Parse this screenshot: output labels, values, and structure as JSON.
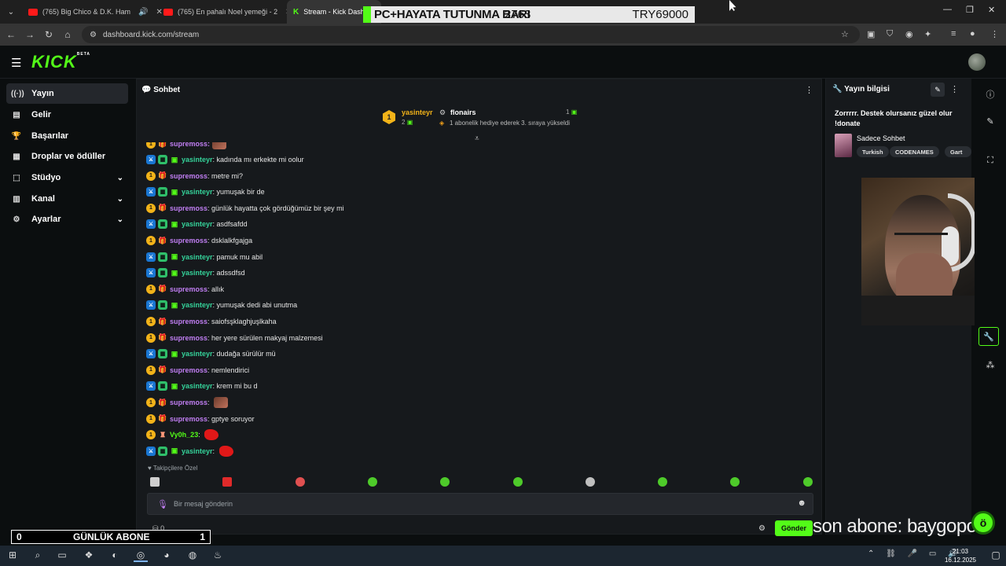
{
  "browser": {
    "tabs": [
      {
        "title": "(765) Big Chico & D.K. Ham",
        "active": false
      },
      {
        "title": "(765) En pahalı Noel yemeği - 2",
        "active": false
      },
      {
        "title": "Stream - Kick Dashboard",
        "active": true
      }
    ],
    "url": "dashboard.kick.com/stream"
  },
  "banner": {
    "text": "PC+HAYATA TUTUNMA BARI",
    "count": "2763",
    "amount": "TRY69000"
  },
  "kick": {
    "logo": "KICK",
    "logo_sup": "BETA"
  },
  "sidebar": {
    "items": [
      {
        "label": "Yayın",
        "icon": "broadcast-icon",
        "active": true
      },
      {
        "label": "Gelir",
        "icon": "revenue-icon"
      },
      {
        "label": "Başarılar",
        "icon": "trophy-icon"
      },
      {
        "label": "Droplar ve ödüller",
        "icon": "drops-icon"
      },
      {
        "label": "Stüdyo",
        "icon": "studio-icon",
        "expandable": true
      },
      {
        "label": "Kanal",
        "icon": "channel-icon",
        "expandable": true
      },
      {
        "label": "Ayarlar",
        "icon": "settings-icon",
        "expandable": true
      }
    ]
  },
  "chat": {
    "title": "Sohbet",
    "pinned": {
      "rank": "1",
      "user": "yasinteyr",
      "subs": "2",
      "gifter": "flonairs",
      "gifter_subs": "1",
      "text": "1 abonelik hediye ederek 3. sıraya yükseldi"
    },
    "messages": [
      {
        "user": "yasinteyr",
        "kind": "yas",
        "text": "kadında mı erkekte mi oolur"
      },
      {
        "user": "supremoss",
        "kind": "sup",
        "text": "metre mi?"
      },
      {
        "user": "yasinteyr",
        "kind": "yas",
        "text": "yumuşak bir de"
      },
      {
        "user": "supremoss",
        "kind": "sup",
        "text": "günlük hayatta çok gördüğümüz bir şey mi"
      },
      {
        "user": "yasinteyr",
        "kind": "yas",
        "text": "asdfsafdd"
      },
      {
        "user": "supremoss",
        "kind": "sup",
        "text": "dsklalkfgajga"
      },
      {
        "user": "yasinteyr",
        "kind": "yas",
        "text": "pamuk mu abil"
      },
      {
        "user": "yasinteyr",
        "kind": "yas",
        "text": "adssdfsd"
      },
      {
        "user": "supremoss",
        "kind": "sup",
        "text": "allık"
      },
      {
        "user": "yasinteyr",
        "kind": "yas",
        "text": "yumuşak dedi abi unutma"
      },
      {
        "user": "supremoss",
        "kind": "sup",
        "text": "saiofsşklaghjuşlkaha"
      },
      {
        "user": "supremoss",
        "kind": "sup",
        "text": "her yere sürülen makyaj malzemesi"
      },
      {
        "user": "yasinteyr",
        "kind": "yas",
        "text": "dudağa sürülür mü"
      },
      {
        "user": "supremoss",
        "kind": "sup",
        "text": "nemlendirici"
      },
      {
        "user": "yasinteyr",
        "kind": "yas",
        "text": "krem mi bu d"
      },
      {
        "user": "supremoss",
        "kind": "sup",
        "text": "",
        "emote": "brown"
      },
      {
        "user": "supremoss",
        "kind": "sup",
        "text": "gptye soruyor"
      },
      {
        "user": "Vy0h_23",
        "kind": "vy",
        "text": "",
        "emote": "red"
      },
      {
        "user": "yasinteyr",
        "kind": "yas",
        "text": "",
        "emote": "red"
      }
    ],
    "followers_label": "Takipçilere Özel",
    "input_placeholder": "Bir mesaj gönderin",
    "footer_count": "0",
    "send_label": "Gönder"
  },
  "info": {
    "title": "Yayın bilgisi",
    "stream_title": "Zorrrrr. Destek olursanız güzel olur !donate",
    "category": "Sadece Sohbet",
    "tags": [
      "Turkish",
      "CODENAMES",
      "Gart"
    ]
  },
  "overlay": {
    "abone_left": "0",
    "abone_label": "GÜNLÜK ABONE",
    "abone_right": "1",
    "ticker": "son abone: baygopo"
  },
  "taskbar": {
    "time": "21:03",
    "date": "16.12.2025"
  },
  "colors": {
    "kick_green": "#53fc18",
    "user_yas": "#35d39a",
    "user_sup": "#c07ef2"
  }
}
